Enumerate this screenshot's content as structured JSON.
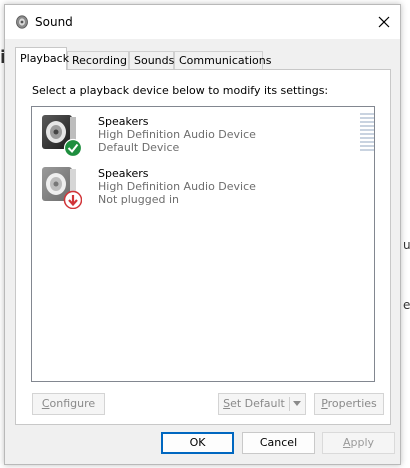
{
  "window": {
    "title": "Sound"
  },
  "tabs": [
    {
      "label": "Playback",
      "active": true
    },
    {
      "label": "Recording",
      "active": false
    },
    {
      "label": "Sounds",
      "active": false
    },
    {
      "label": "Communications",
      "active": false
    }
  ],
  "instruction": "Select a playback device below to modify its settings:",
  "devices": [
    {
      "name": "Speakers",
      "driver": "High Definition Audio Device",
      "status": "Default Device",
      "badge": "check-icon",
      "badge_color": "#1e8e3e"
    },
    {
      "name": "Speakers",
      "driver": "High Definition Audio Device",
      "status": "Not plugged in",
      "badge": "down-arrow-icon",
      "badge_color": "#d13438"
    }
  ],
  "buttons": {
    "configure": {
      "mnemonic": "C",
      "rest": "onfigure"
    },
    "set_default": {
      "mnemonic": "S",
      "rest": "et Default"
    },
    "properties": {
      "mnemonic": "P",
      "rest": "roperties"
    },
    "ok": "OK",
    "cancel": "Cancel",
    "apply": {
      "mnemonic": "A",
      "rest": "pply"
    }
  },
  "background_fragments": [
    "i",
    "u",
    "e"
  ],
  "colors": {
    "accent": "#0067c0",
    "meter": "#c9d3e0"
  }
}
